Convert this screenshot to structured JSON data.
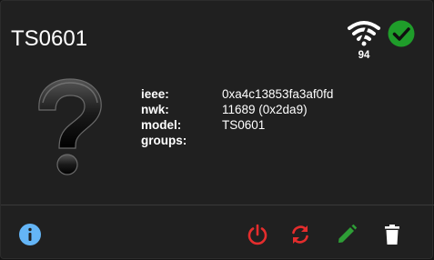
{
  "device": {
    "title": "TS0601",
    "signal_strength": "94",
    "icons": {
      "signal": "wifi-signal-icon",
      "status": "check-circle-icon",
      "image": "question-mark-icon"
    },
    "info": [
      {
        "label": "ieee:",
        "value": "0xa4c13853fa3af0fd"
      },
      {
        "label": "nwk:",
        "value": "11689 (0x2da9)"
      },
      {
        "label": "model:",
        "value": "TS0601"
      },
      {
        "label": "groups:",
        "value": ""
      }
    ]
  },
  "footer": {
    "info_icon": "info-icon",
    "actions": [
      "power-icon",
      "refresh-icon",
      "pencil-icon",
      "trash-icon"
    ]
  },
  "colors": {
    "card_background": "#202020",
    "info_blue": "#64b5f6",
    "danger_red": "#e52d2d",
    "success_green": "#1f9d2a",
    "edit_green": "#2e9e36",
    "white": "#ffffff"
  }
}
